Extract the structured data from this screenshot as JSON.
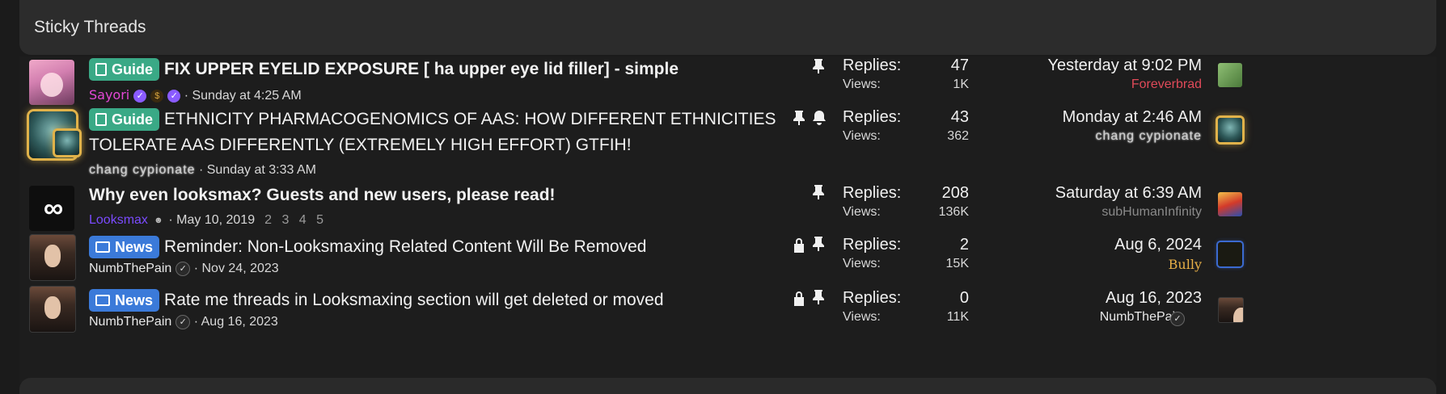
{
  "header": {
    "title": "Sticky Threads"
  },
  "labels": {
    "replies": "Replies:",
    "views": "Views:"
  },
  "threads": [
    {
      "prefix": "Guide",
      "title": "FIX UPPER EYELID EXPOSURE [ ha upper eye lid filler] - simple",
      "author": "Sayori",
      "date": "Sunday at 4:25 AM",
      "replies": "47",
      "views": "1K",
      "last_date": "Yesterday at 9:02 PM",
      "last_user": "Foreverbrad",
      "icons": [
        "pin-icon"
      ]
    },
    {
      "prefix": "Guide",
      "title_line1": "ETHNICITY PHARMACOGENOMICS OF AAS: HOW DIFFERENT ETHNICITIES",
      "title_line2": "TOLERATE AAS DIFFERENTLY (EXTREMELY HIGH EFFORT) GTFIH!",
      "author": "chang cypionate",
      "date": "Sunday at 3:33 AM",
      "replies": "43",
      "views": "362",
      "last_date": "Monday at 2:46 AM",
      "last_user": "chang cypionate",
      "icons": [
        "pin-icon",
        "bell-icon"
      ]
    },
    {
      "title": "Why even looksmax? Guests and new users, please read!",
      "author": "Looksmax",
      "date": "May 10, 2019",
      "pages": "2 3 4 5",
      "replies": "208",
      "views": "136K",
      "last_date": "Saturday at 6:39 AM",
      "last_user": "subHumanInfinity",
      "icons": [
        "pin-icon"
      ]
    },
    {
      "prefix": "News",
      "title": "Reminder: Non-Looksmaxing Related Content Will Be Removed",
      "author": "NumbThePain",
      "date": "Nov 24, 2023",
      "replies": "2",
      "views": "15K",
      "last_date": "Aug 6, 2024",
      "last_user": "Bully",
      "icons": [
        "lock-icon",
        "pin-icon"
      ]
    },
    {
      "prefix": "News",
      "title": "Rate me threads in Looksmaxing section will get deleted or moved",
      "author": "NumbThePain",
      "date": "Aug 16, 2023",
      "replies": "0",
      "views": "11K",
      "last_date": "Aug 16, 2023",
      "last_user": "NumbThePain",
      "icons": [
        "lock-icon",
        "pin-icon"
      ]
    }
  ],
  "colors": {
    "guide": "#3aa986",
    "news": "#3b7ad9",
    "pink_user": "#e447d6",
    "purple_user": "#7b4bff",
    "red_user": "#e04a59",
    "gold_user": "#e8b047"
  }
}
